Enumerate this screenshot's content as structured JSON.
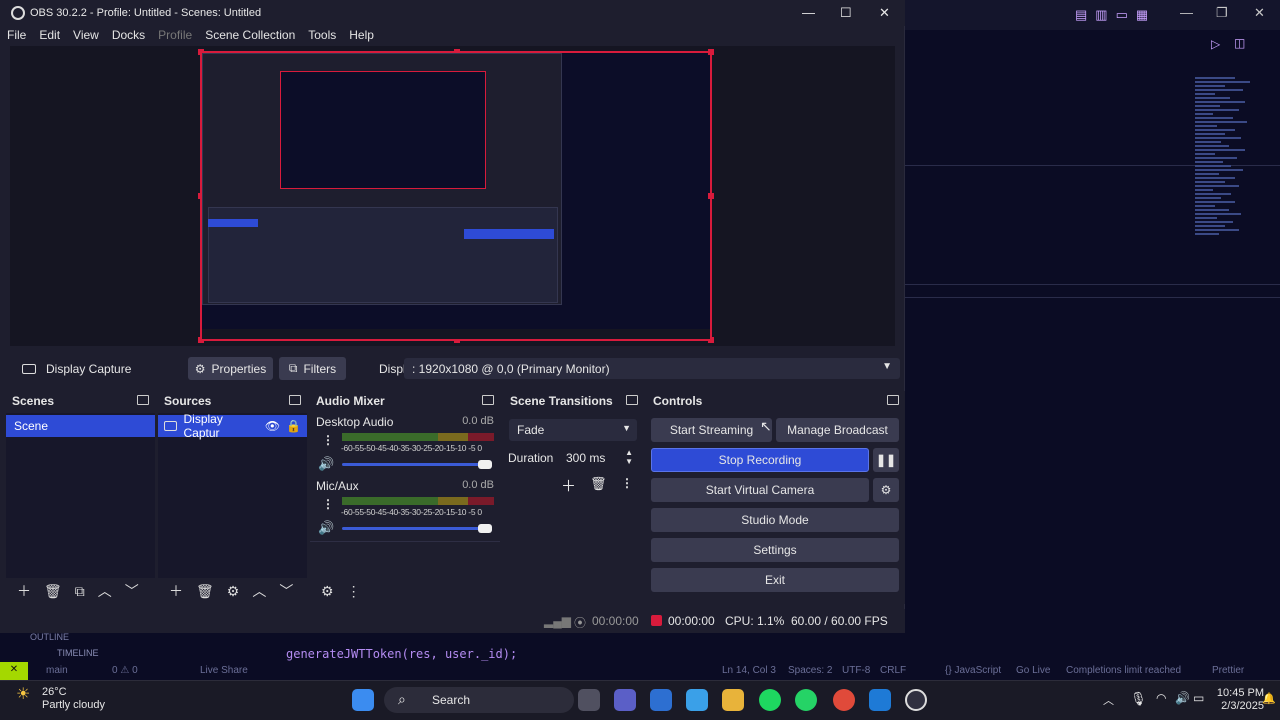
{
  "window": {
    "title": "OBS 30.2.2 - Profile: Untitled - Scenes: Untitled"
  },
  "menu": [
    "File",
    "Edit",
    "View",
    "Docks",
    "Profile",
    "Scene Collection",
    "Tools",
    "Help"
  ],
  "source_toolbar": {
    "source_name": "Display Capture",
    "properties_label": "Properties",
    "filters_label": "Filters",
    "display_label": "Display",
    "display_value": ": 1920x1080 @ 0,0 (Primary Monitor)"
  },
  "scenes": {
    "title": "Scenes",
    "items": [
      "Scene"
    ]
  },
  "sources": {
    "title": "Sources",
    "items": [
      "Display Captur"
    ]
  },
  "audio_mixer": {
    "title": "Audio Mixer",
    "channels": [
      {
        "name": "Desktop Audio",
        "level": "0.0 dB",
        "volume": 1.0
      },
      {
        "name": "Mic/Aux",
        "level": "0.0 dB",
        "volume": 1.0
      }
    ],
    "scale": "-60-55-50-45-40-35-30-25-20-15-10 -5 0"
  },
  "transitions": {
    "title": "Scene Transitions",
    "selected": "Fade",
    "duration_label": "Duration",
    "duration_value": "300 ms"
  },
  "controls": {
    "title": "Controls",
    "start_streaming": "Start Streaming",
    "manage_broadcast": "Manage Broadcast",
    "stop_recording": "Stop Recording",
    "start_virtual_camera": "Start Virtual Camera",
    "studio_mode": "Studio Mode",
    "settings": "Settings",
    "exit": "Exit"
  },
  "status": {
    "stream_time": "00:00:00",
    "rec_time": "00:00:00",
    "cpu": "CPU: 1.1%",
    "fps": "60.00 / 60.00 FPS"
  },
  "editor": {
    "outline_label": "OUTLINE",
    "timeline_label": "TIMELINE",
    "code_line": "generateJWTToken(res, user._id);",
    "status_branch": "main",
    "status_live": "Live Share",
    "status_errors": "0 ⚠ 0",
    "status_right": [
      "Ln 14, Col 3",
      "Spaces: 2",
      "UTF-8",
      "CRLF",
      "{} JavaScript",
      "Go Live",
      "Completions limit reached",
      "Prettier"
    ]
  },
  "taskbar": {
    "weather_temp": "26°C",
    "weather_desc": "Partly cloudy",
    "search_placeholder": "Search",
    "time": "10:45 PM",
    "date": "2/3/2025"
  },
  "colors": {
    "accent": "#2e4bd6",
    "recording": "#d81b3c",
    "bg": "#1e1e2e"
  }
}
